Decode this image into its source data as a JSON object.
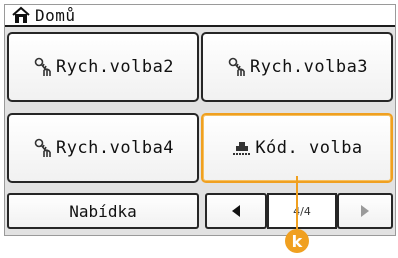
{
  "header": {
    "title": "Domů",
    "icon": "home-icon"
  },
  "buttons": [
    {
      "label": "Rych.volba2",
      "icon": "speed-dial-icon"
    },
    {
      "label": "Rych.volba3",
      "icon": "speed-dial-icon"
    },
    {
      "label": "Rych.volba4",
      "icon": "speed-dial-icon"
    },
    {
      "label": "Kód. volba",
      "icon": "coded-dial-icon",
      "highlighted": true
    }
  ],
  "bottom": {
    "menu_label": "Nabídka",
    "prev_icon": "triangle-left-icon",
    "page": "4/4",
    "next_icon": "triangle-right-icon"
  },
  "callout": {
    "label": "k",
    "color": "#f0a020"
  }
}
